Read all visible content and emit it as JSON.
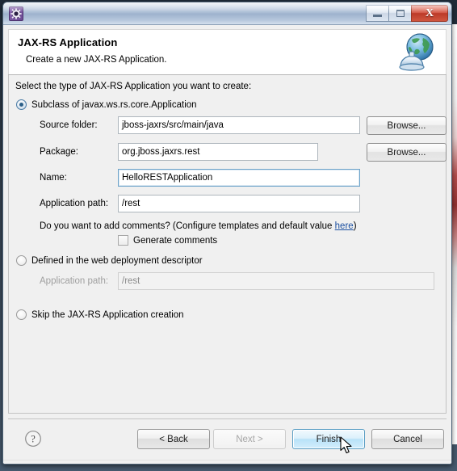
{
  "window": {
    "icon": "gear-icon",
    "title": "",
    "controls": {
      "minimize": "minimize-icon",
      "maximize": "maximize-icon",
      "close": "X"
    }
  },
  "header": {
    "title": "JAX-RS Application",
    "subtitle": "Create a new JAX-RS Application.",
    "icon": "web-service-globe-icon"
  },
  "body": {
    "lead": "Select the type of JAX-RS Application you want to create:",
    "option_subclass": {
      "label": "Subclass of javax.ws.rs.core.Application",
      "selected": true,
      "fields": [
        {
          "label": "Source folder:",
          "value": "jboss-jaxrs/src/main/java",
          "focused": false,
          "browse": "Browse..."
        },
        {
          "label": "Package:",
          "value": "org.jboss.jaxrs.rest",
          "focused": false,
          "browse": "Browse..."
        },
        {
          "label": "Name:",
          "value": "HelloRESTApplication",
          "focused": true
        },
        {
          "label": "Application path:",
          "value": "/rest",
          "focused": false
        }
      ],
      "comments_hint_before": "Do you want to add comments? (Configure templates and default value ",
      "comments_hint_link": "here",
      "comments_hint_after": ")",
      "generate_comments_label": "Generate comments",
      "generate_comments_checked": false
    },
    "option_descriptor": {
      "label": "Defined in the web deployment descriptor",
      "selected": false,
      "field_label": "Application path:",
      "field_value": "/rest",
      "disabled": true
    },
    "option_skip": {
      "label": "Skip the JAX-RS Application creation",
      "selected": false
    }
  },
  "footer": {
    "help": "help-icon",
    "back": "< Back",
    "next": "Next >",
    "finish": "Finish",
    "cancel": "Cancel",
    "next_disabled": true,
    "finish_highlighted": true
  },
  "colors": {
    "link": "#1b4fa0",
    "focus_border": "#6da3c9",
    "radio_dot": "#2c5f88",
    "close_button": "#bc3a28",
    "titlebar": "#a9bcd4"
  }
}
